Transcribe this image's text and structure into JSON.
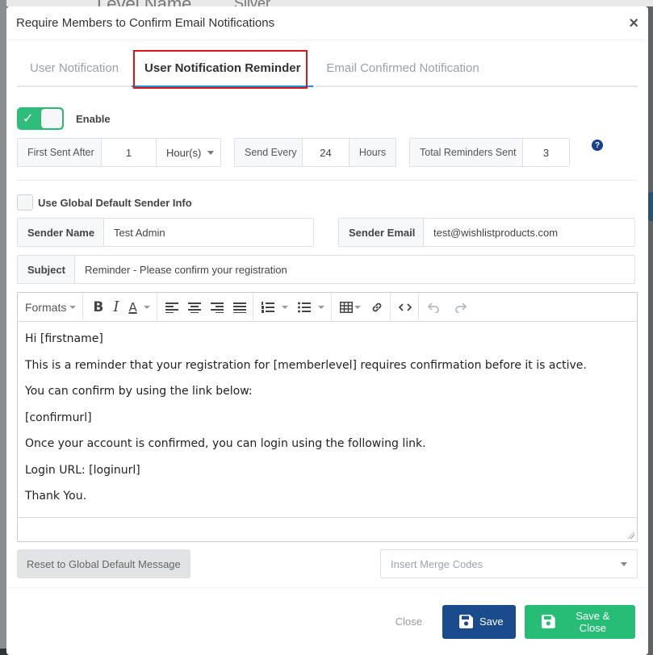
{
  "background": {
    "left_text": "Level Name",
    "right_text": "Silver"
  },
  "modal": {
    "title": "Require Members to Confirm Email Notifications",
    "close_glyph": "×"
  },
  "tabs": [
    {
      "label": "User Notification",
      "active": false
    },
    {
      "label": "User Notification Reminder",
      "active": true
    },
    {
      "label": "Email Confirmed Notification",
      "active": false
    }
  ],
  "enable": {
    "label": "Enable",
    "on": true
  },
  "schedule": {
    "first_sent_after_label": "First Sent After",
    "first_sent_after_value": "1",
    "first_sent_unit": "Hour(s)",
    "send_every_label": "Send Every",
    "send_every_value": "24",
    "send_every_unit": "Hours",
    "total_reminders_label": "Total Reminders Sent",
    "total_reminders_value": "3",
    "help_glyph": "?"
  },
  "sender": {
    "use_global_label": "Use Global Default Sender Info",
    "use_global_checked": false,
    "name_label": "Sender Name",
    "name_value": "Test Admin",
    "email_label": "Sender Email",
    "email_value": "test@wishlistproducts.com"
  },
  "subject": {
    "label": "Subject",
    "value": "Reminder - Please confirm your registration"
  },
  "editor": {
    "formats_label": "Formats",
    "lines": [
      "Hi [firstname]",
      "This is a reminder that your registration for [memberlevel] requires confirmation before it is active.",
      "You can confirm by using the link below:",
      "[confirmurl]",
      "Once your account is confirmed, you can login using the following link.",
      "Login URL: [loginurl]",
      "Thank You."
    ]
  },
  "actions": {
    "reset_label": "Reset to Global Default Message",
    "merge_codes_placeholder": "Insert Merge Codes",
    "close_label": "Close",
    "save_label": "Save",
    "save_close_label": "Save & Close"
  },
  "colors": {
    "tab_highlight": "#d9141b",
    "toggle_on": "#2ebd7a",
    "save_button": "#1a4b8c",
    "save_close_button": "#27bd77",
    "help_icon": "#18408a"
  }
}
